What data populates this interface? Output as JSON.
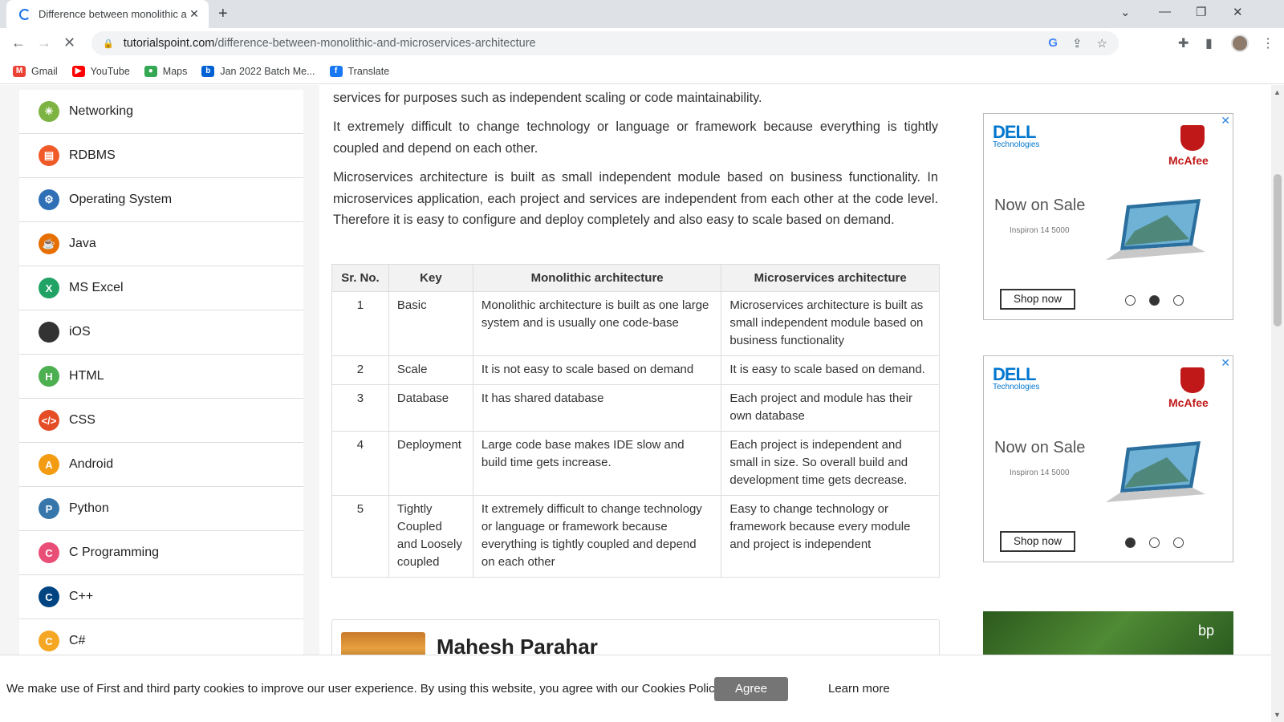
{
  "browser": {
    "tab_title": "Difference between monolithic a",
    "new_tab": "+",
    "url_domain": "tutorialspoint.com",
    "url_path": "/difference-between-monolithic-and-microservices-architecture",
    "bookmarks": [
      {
        "label": "Gmail",
        "icon": "gmail-icon",
        "color": "#ea4335",
        "glyph": "M"
      },
      {
        "label": "YouTube",
        "icon": "youtube-icon",
        "color": "#ff0000",
        "glyph": "▶"
      },
      {
        "label": "Maps",
        "icon": "maps-icon",
        "color": "#34a853",
        "glyph": "●"
      },
      {
        "label": "Jan 2022 Batch Me...",
        "icon": "box-icon",
        "color": "#0061d5",
        "glyph": "b"
      },
      {
        "label": "Translate",
        "icon": "facebook-icon",
        "color": "#1877f2",
        "glyph": "f"
      }
    ]
  },
  "sidebar": {
    "items": [
      {
        "label": "Networking",
        "icon": "networking-icon",
        "color": "#7cb342",
        "glyph": "✳"
      },
      {
        "label": "RDBMS",
        "icon": "rdbms-icon",
        "color": "#f05a28",
        "glyph": "▤"
      },
      {
        "label": "Operating System",
        "icon": "operating-system-icon",
        "color": "#2f6fb6",
        "glyph": "⚙"
      },
      {
        "label": "Java",
        "icon": "java-icon",
        "color": "#e76f00",
        "glyph": "☕"
      },
      {
        "label": "MS Excel",
        "icon": "ms-excel-icon",
        "color": "#21a366",
        "glyph": "X"
      },
      {
        "label": "iOS",
        "icon": "apple-icon",
        "color": "#333333",
        "glyph": ""
      },
      {
        "label": "HTML",
        "icon": "html-icon",
        "color": "#4caf50",
        "glyph": "H"
      },
      {
        "label": "CSS",
        "icon": "css-icon",
        "color": "#e44d26",
        "glyph": "</>"
      },
      {
        "label": "Android",
        "icon": "android-icon",
        "color": "#f39c12",
        "glyph": "A"
      },
      {
        "label": "Python",
        "icon": "python-icon",
        "color": "#3776ab",
        "glyph": "P"
      },
      {
        "label": "C Programming",
        "icon": "c-programming-icon",
        "color": "#e94e77",
        "glyph": "C"
      },
      {
        "label": "C++",
        "icon": "cpp-icon",
        "color": "#004482",
        "glyph": "C"
      },
      {
        "label": "C#",
        "icon": "csharp-icon",
        "color": "#f5a623",
        "glyph": "C"
      }
    ]
  },
  "article": {
    "p1": "services for purposes such as independent scaling or code maintainability.",
    "p2": "It extremely difficult to change technology or language or framework because everything is tightly coupled and depend on each other.",
    "p3": "Microservices architecture is built as small independent module based on business functionality. In microservices application, each project and services are independent from each other at the code level. Therefore it is easy to  configure and deploy completely and also easy to scale based on demand.",
    "table": {
      "headers": [
        "Sr. No.",
        "Key",
        "Monolithic architecture",
        "Microservices architecture"
      ],
      "rows": [
        [
          "1",
          "Basic",
          "Monolithic architecture is built as one large system and is usually one code-base",
          "Microservices architecture is built as small independent module based on business functionality"
        ],
        [
          "2",
          "Scale",
          "It is not easy to scale based on demand",
          "It is easy to scale based on demand."
        ],
        [
          "3",
          "Database",
          "It has shared database",
          "Each project and module has their own database"
        ],
        [
          "4",
          "Deployment",
          "Large code base makes IDE slow and build time gets increase.",
          "Each project is independent and small in size. So overall build and development time gets decrease."
        ],
        [
          "5",
          "Tightly Coupled and Loosely coupled",
          "It extremely difficult to change technology or language or framework because everything is tightly coupled and depend on each other",
          "Easy to change technology or framework because every module and project is independent"
        ]
      ]
    },
    "author_name": "Mahesh Parahar"
  },
  "ads": [
    {
      "brand": "DELL",
      "brand_sub": "Technologies",
      "partner": "McAfee",
      "headline": "Now on Sale",
      "model": "Inspiron 14 5000",
      "cta": "Shop now",
      "active_dot": 1
    },
    {
      "brand": "DELL",
      "brand_sub": "Technologies",
      "partner": "McAfee",
      "headline": "Now on Sale",
      "model": "Inspiron 14 5000",
      "cta": "Shop now",
      "active_dot": 0
    }
  ],
  "ad3_logo": "bp",
  "cookie": {
    "message": "We make use of First and third party cookies to improve our user experience. By using this website, you agree with our Cookies Policy.",
    "agree": "Agree",
    "learn_more": "Learn more"
  }
}
